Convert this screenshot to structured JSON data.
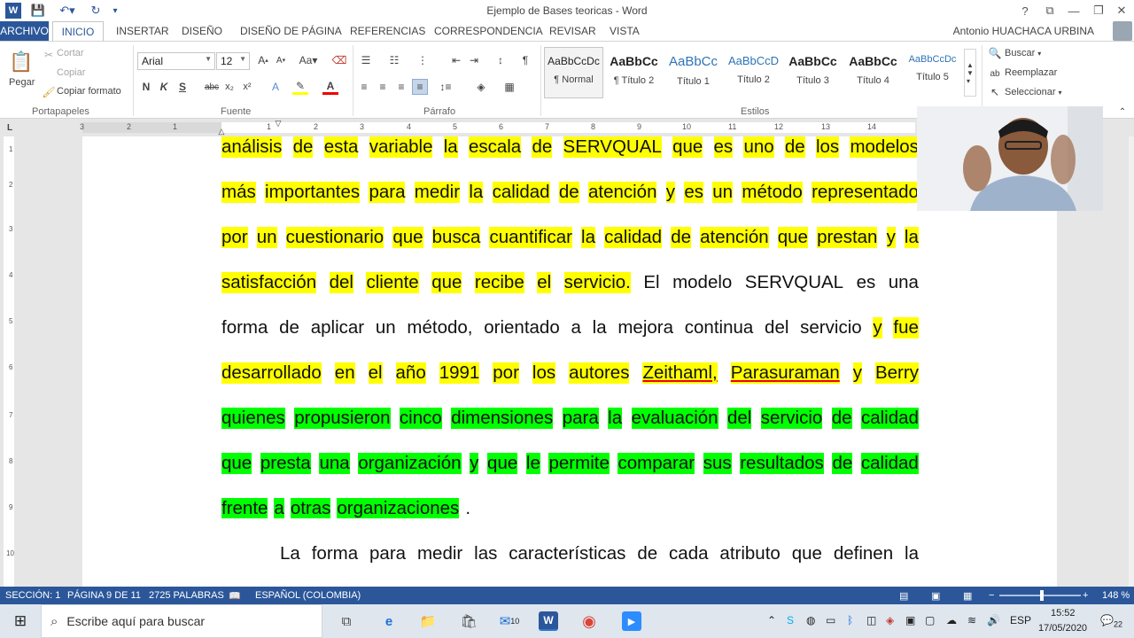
{
  "window": {
    "title": "Ejemplo de Bases  teoricas - Word",
    "controls": [
      "?",
      "⧉",
      "—",
      "❐",
      "✕"
    ]
  },
  "tabs": {
    "archivo": "ARCHIVO",
    "inicio": "INICIO",
    "insertar": "INSERTAR",
    "diseno": "DISEÑO",
    "diseno_pagina": "DISEÑO DE PÁGINA",
    "referencias": "REFERENCIAS",
    "correspondencia": "CORRESPONDENCIA",
    "revisar": "REVISAR",
    "vista": "VISTA",
    "user": "Antonio HUACHACA URBINA"
  },
  "clipboard": {
    "paste": "Pegar",
    "cut": "Cortar",
    "copy": "Copiar",
    "format_painter": "Copiar formato",
    "group": "Portapapeles"
  },
  "font": {
    "name": "Arial",
    "size": "12",
    "group": "Fuente",
    "bold": "N",
    "italic": "K",
    "underline": "S"
  },
  "paragraph": {
    "group": "Párrafo"
  },
  "styles": {
    "group": "Estilos",
    "items": [
      {
        "preview": "AaBbCcDc",
        "name": "¶ Normal"
      },
      {
        "preview": "AaBbCc",
        "name": "¶ Título 2"
      },
      {
        "preview": "AaBbCc",
        "name": "Título 1"
      },
      {
        "preview": "AaBbCcD",
        "name": "Título 2"
      },
      {
        "preview": "AaBbCc",
        "name": "Título 3"
      },
      {
        "preview": "AaBbCc",
        "name": "Título 4"
      },
      {
        "preview": "AaBbCcDc",
        "name": "Título 5"
      }
    ]
  },
  "editing": {
    "find": "Buscar",
    "replace": "Reemplazar",
    "select": "Seleccionar"
  },
  "ruler": {
    "h": [
      "3",
      "2",
      "1",
      "1",
      "2",
      "3",
      "4",
      "5",
      "6",
      "7",
      "8",
      "9",
      "10",
      "11",
      "12",
      "13",
      "14"
    ],
    "v": [
      "1",
      "2",
      "3",
      "4",
      "5",
      "6",
      "7",
      "8",
      "9",
      "10"
    ]
  },
  "document": {
    "lines": [
      [
        {
          "t": "análisis de esta variable la escala de SERVQUAL que es uno de los modelos",
          "h": "y"
        }
      ],
      [
        {
          "t": "más importantes para medir la calidad de atención y es un método representado",
          "h": "y"
        }
      ],
      [
        {
          "t": "por un cuestionario que busca cuantificar la calidad de atención que prestan y la",
          "h": "y"
        }
      ],
      [
        {
          "t": "satisfacción del cliente que recibe el servicio.",
          "h": "y"
        },
        {
          "t": " El modelo SERVQUAL es una",
          "h": ""
        }
      ],
      [
        {
          "t": "forma de aplicar un método, orientado a la mejora continua del servicio ",
          "h": ""
        },
        {
          "t": "y fue",
          "h": "y"
        }
      ],
      [
        {
          "t": "desarrollado en el año 1991 por los autores Zeithaml, Parasuraman y Berry",
          "h": "y"
        }
      ],
      [
        {
          "t": "quienes propusieron cinco dimensiones para la evaluación del servicio de calidad",
          "h": "g"
        }
      ],
      [
        {
          "t": "que presta una organización y que le permite comparar sus resultados de calidad",
          "h": "g"
        }
      ],
      [
        {
          "t": "frente a otras organizaciones",
          "h": "g"
        },
        {
          "t": ".",
          "h": ""
        }
      ],
      [
        {
          "t": "La forma para medir las características de cada atributo que definen la",
          "h": ""
        }
      ]
    ]
  },
  "status": {
    "section": "SECCIÓN: 1",
    "page": "PÁGINA 9 DE 11",
    "words": "2725 PALABRAS",
    "language": "ESPAÑOL (COLOMBIA)",
    "zoom": "148 %"
  },
  "taskbar": {
    "search_placeholder": "Escribe aquí para buscar",
    "mail_badge": "10",
    "lang": "ESP",
    "time": "15:52",
    "date": "17/05/2020",
    "notif": "22"
  }
}
